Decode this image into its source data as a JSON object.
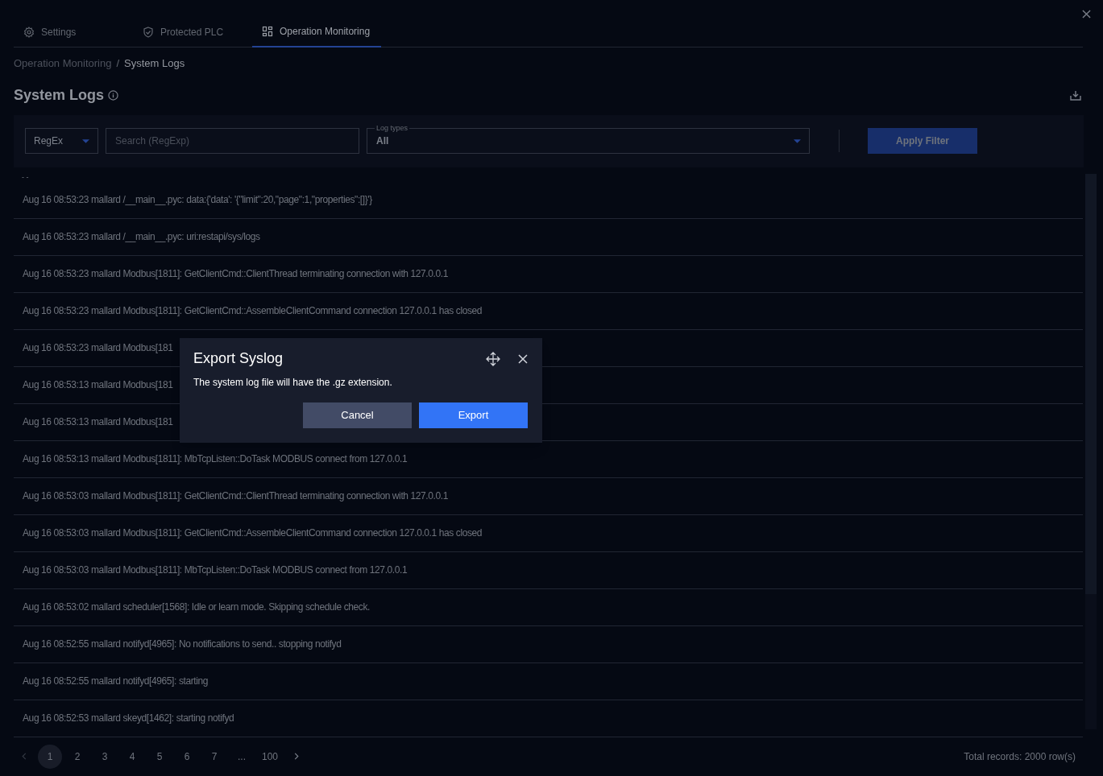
{
  "tabs": [
    {
      "label": "Settings",
      "selected": false
    },
    {
      "label": "Protected PLC",
      "selected": false
    },
    {
      "label": "Operation Monitoring",
      "selected": true
    }
  ],
  "breadcrumb": [
    "Operation Monitoring",
    "System Logs"
  ],
  "breadcrumb_separator": "/",
  "page_title": "System Logs",
  "filter": {
    "mode": "RegEx",
    "search_placeholder": "Search (RegExp)",
    "log_types_label": "Log types",
    "log_types_value": "All",
    "apply_button": "Apply Filter"
  },
  "clipped_row": "- -",
  "log_rows": [
    "Aug 16 08:53:23 mallard /__main__.pyc: data:{'data': '{\"limit\":20,\"page\":1,\"properties\":[]}'}",
    "Aug 16 08:53:23 mallard /__main__.pyc: uri:restapi/sys/logs",
    "Aug 16 08:53:23 mallard Modbus[1811]: GetClientCmd::ClientThread terminating connection with 127.0.0.1",
    "Aug 16 08:53:23 mallard Modbus[1811]: GetClientCmd::AssembleClientCommand connection 127.0.0.1 has closed",
    "Aug 16 08:53:23 mallard Modbus[181",
    "Aug 16 08:53:13 mallard Modbus[181",
    "Aug 16 08:53:13 mallard Modbus[181",
    "Aug 16 08:53:13 mallard Modbus[1811]: MbTcpListen::DoTask MODBUS connect from 127.0.0.1",
    "Aug 16 08:53:03 mallard Modbus[1811]: GetClientCmd::ClientThread terminating connection with 127.0.0.1",
    "Aug 16 08:53:03 mallard Modbus[1811]: GetClientCmd::AssembleClientCommand connection 127.0.0.1 has closed",
    "Aug 16 08:53:03 mallard Modbus[1811]: MbTcpListen::DoTask MODBUS connect from 127.0.0.1",
    "Aug 16 08:53:02 mallard scheduler[1568]: Idle or learn mode. Skipping schedule check.",
    "Aug 16 08:52:55 mallard notifyd[4965]: No notifications to send.. stopping notifyd",
    "Aug 16 08:52:55 mallard notifyd[4965]: starting",
    "Aug 16 08:52:53 mallard skeyd[1462]: starting notifyd"
  ],
  "pagination": {
    "pages": [
      {
        "label": "1",
        "selected": true
      },
      {
        "label": "2",
        "selected": false
      },
      {
        "label": "3",
        "selected": false
      },
      {
        "label": "4",
        "selected": false
      },
      {
        "label": "5",
        "selected": false
      },
      {
        "label": "6",
        "selected": false
      },
      {
        "label": "7",
        "selected": false
      },
      {
        "label": "...",
        "selected": false
      },
      {
        "label": "100",
        "selected": false
      }
    ],
    "total": "Total records: 2000 row(s)"
  },
  "dialog": {
    "title": "Export Syslog",
    "message": "The system log file will have the .gz extension.",
    "cancel": "Cancel",
    "confirm": "Export"
  }
}
